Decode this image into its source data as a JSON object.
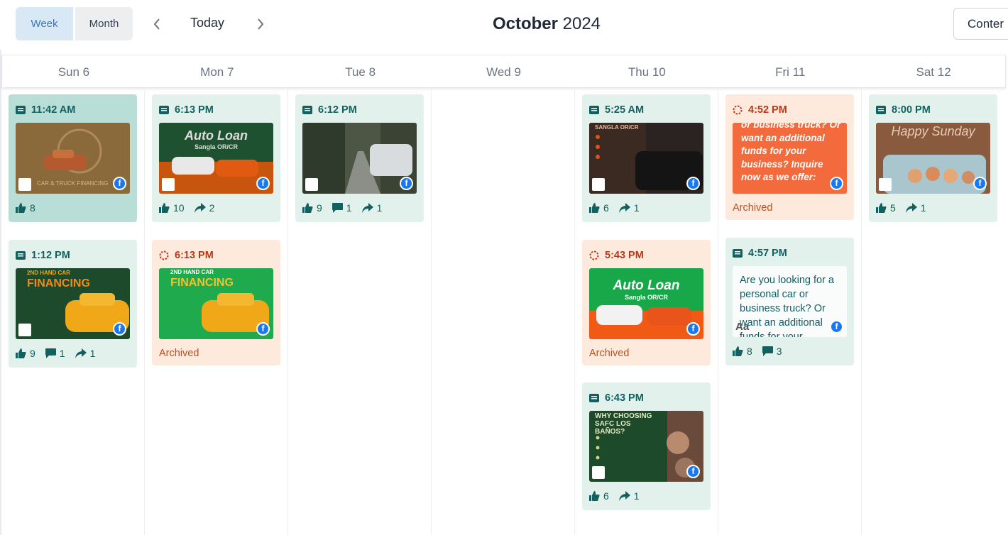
{
  "toolbar": {
    "view_week": "Week",
    "view_month": "Month",
    "today": "Today",
    "title_month": "October",
    "title_year": "2024",
    "content_button": "Conter"
  },
  "days": [
    "Sun 6",
    "Mon 7",
    "Tue 8",
    "Wed 9",
    "Thu 10",
    "Fri 11",
    "Sat 12"
  ],
  "posts": {
    "sun_1": {
      "time": "11:42 AM",
      "likes": "8"
    },
    "sun_2": {
      "time": "1:12 PM",
      "likes": "9",
      "comments": "1",
      "shares": "1",
      "image_text": "2ND HAND CAR FINANCING"
    },
    "mon_1": {
      "time": "6:13 PM",
      "likes": "10",
      "shares": "2",
      "image_text": "Auto Loan",
      "image_sub": "Sangla OR/CR"
    },
    "mon_2": {
      "time": "6:13 PM",
      "status": "Archived",
      "image_text": "2ND HAND CAR FINANCING"
    },
    "tue_1": {
      "time": "6:12 PM",
      "likes": "9",
      "comments": "1",
      "shares": "1"
    },
    "thu_1": {
      "time": "5:25 AM",
      "likes": "6",
      "shares": "1",
      "image_text": "SANGLA OR/CR"
    },
    "thu_2": {
      "time": "5:43 PM",
      "status": "Archived",
      "image_text": "Auto Loan",
      "image_sub": "Sangla OR/CR"
    },
    "thu_3": {
      "time": "6:43 PM",
      "likes": "6",
      "shares": "1",
      "image_text": "WHY CHOOSING SAFC LOS BAÑOS?"
    },
    "fri_1": {
      "time": "4:52 PM",
      "status": "Archived",
      "image_text": "or business truck? Or want an additional funds for your business? Inquire now as we offer:"
    },
    "fri_2": {
      "time": "4:57 PM",
      "likes": "8",
      "comments": "3",
      "text": "Are you looking for a personal car or business truck? Or want an additional funds for your"
    },
    "sat_1": {
      "time": "8:00 PM",
      "likes": "5",
      "shares": "1",
      "image_text": "Happy Sunday"
    }
  },
  "colors": {
    "accent": "#12615f",
    "scheduled_bg": "#e3f1ec",
    "failed_bg": "#fdeadc",
    "failed_text": "#b33a1a",
    "facebook": "#1877f2"
  },
  "icons": [
    "chevron-left-icon",
    "chevron-right-icon",
    "post-icon",
    "pending-icon",
    "like-icon",
    "comment-icon",
    "share-icon",
    "image-icon",
    "facebook-icon",
    "text-icon"
  ]
}
